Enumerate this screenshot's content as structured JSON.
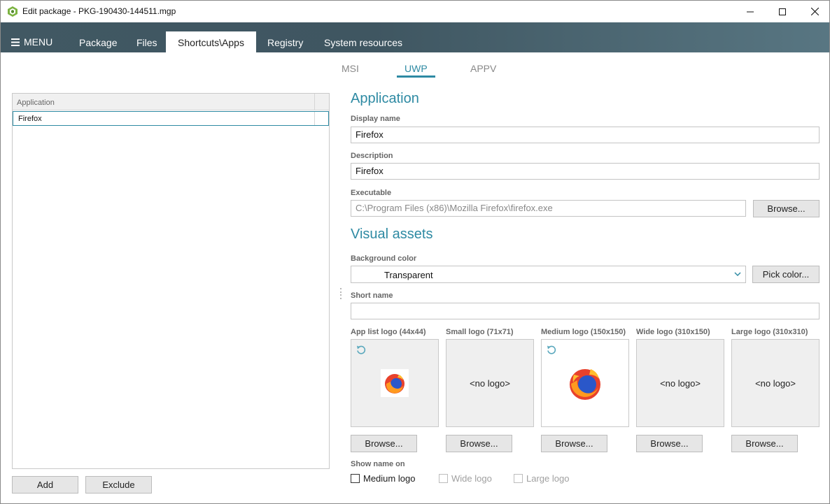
{
  "window": {
    "title": "Edit package - PKG-190430-144511.mgp",
    "icon": "package-icon"
  },
  "nav": {
    "menu_label": "MENU",
    "tabs": [
      {
        "label": "Package"
      },
      {
        "label": "Files"
      },
      {
        "label": "Shortcuts\\Apps",
        "active": true
      },
      {
        "label": "Registry"
      },
      {
        "label": "System resources"
      }
    ]
  },
  "subtabs": [
    {
      "label": "MSI"
    },
    {
      "label": "UWP",
      "active": true
    },
    {
      "label": "APPV"
    }
  ],
  "app_list": {
    "column_header": "Application",
    "rows": [
      "Firefox"
    ],
    "add_label": "Add",
    "exclude_label": "Exclude"
  },
  "application": {
    "section_title": "Application",
    "display_name_label": "Display name",
    "display_name_value": "Firefox",
    "description_label": "Description",
    "description_value": "Firefox",
    "executable_label": "Executable",
    "executable_value": "C:\\Program Files (x86)\\Mozilla Firefox\\firefox.exe",
    "browse_label": "Browse..."
  },
  "visual_assets": {
    "section_title": "Visual assets",
    "background_color_label": "Background color",
    "background_color_value": "Transparent",
    "pick_color_label": "Pick color...",
    "short_name_label": "Short name",
    "short_name_value": "",
    "logos": [
      {
        "label": "App list logo (44x44)",
        "has_logo": true,
        "browse": "Browse..."
      },
      {
        "label": "Small logo (71x71)",
        "has_logo": false,
        "placeholder": "<no logo>",
        "browse": "Browse..."
      },
      {
        "label": "Medium logo (150x150)",
        "has_logo": true,
        "browse": "Browse..."
      },
      {
        "label": "Wide logo (310x150)",
        "has_logo": false,
        "placeholder": "<no logo>",
        "browse": "Browse..."
      },
      {
        "label": "Large logo (310x310)",
        "has_logo": false,
        "placeholder": "<no logo>",
        "browse": "Browse..."
      }
    ],
    "show_name_label": "Show name on",
    "show_name_options": [
      {
        "label": "Medium logo",
        "checked": false,
        "enabled": true
      },
      {
        "label": "Wide logo",
        "checked": false,
        "enabled": false
      },
      {
        "label": "Large logo",
        "checked": false,
        "enabled": false
      }
    ]
  },
  "colors": {
    "accent": "#2e8aa3",
    "navbar": "#415863"
  }
}
